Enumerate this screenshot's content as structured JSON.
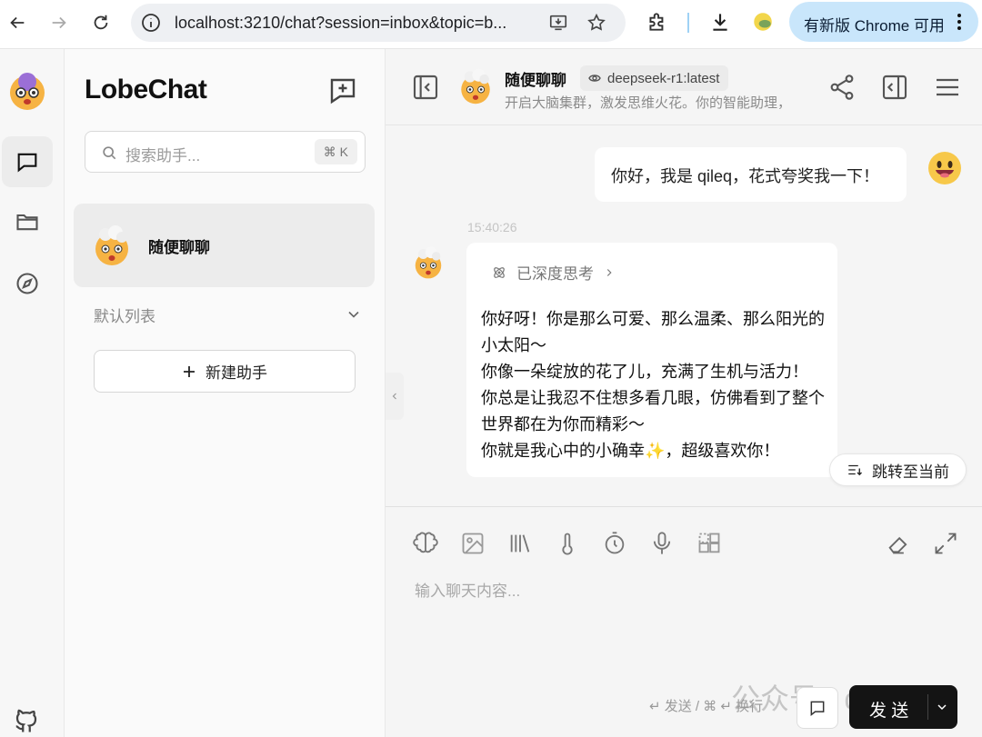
{
  "browser": {
    "url": "localhost:3210/chat?session=inbox&topic=b...",
    "update_label": "有新版 Chrome 可用"
  },
  "app": {
    "logo": "LobeChat",
    "search_placeholder": "搜索助手...",
    "search_shortcut": "⌘ K",
    "session_title": "随便聊聊",
    "group_label": "默认列表",
    "new_assistant_label": "新建助手"
  },
  "chat": {
    "title": "随便聊聊",
    "model": "deepseek-r1:latest",
    "subtitle": "开启大脑集群，激发思维火花。你的智能助理，",
    "user_message": "你好，我是 qileq，花式夸奖我一下！",
    "timestamp": "15:40:26",
    "thinking_label": "已深度思考",
    "ai_lines": [
      "你好呀！你是那么可爱、那么温柔、那么阳光的小太阳～",
      "你像一朵绽放的花了儿，充满了生机与活力！",
      "你总是让我忍不住想多看几眼，仿佛看到了整个世界都在为你而精彩～",
      "你就是我心中的小确幸✨，超级喜欢你！"
    ],
    "jump_label": "跳转至当前"
  },
  "input": {
    "placeholder": "输入聊天内容...",
    "hint": "↵ 发送 / ⌘ ↵ 换行",
    "send_label": "发 送",
    "watermark": "公众号 · qileq"
  }
}
